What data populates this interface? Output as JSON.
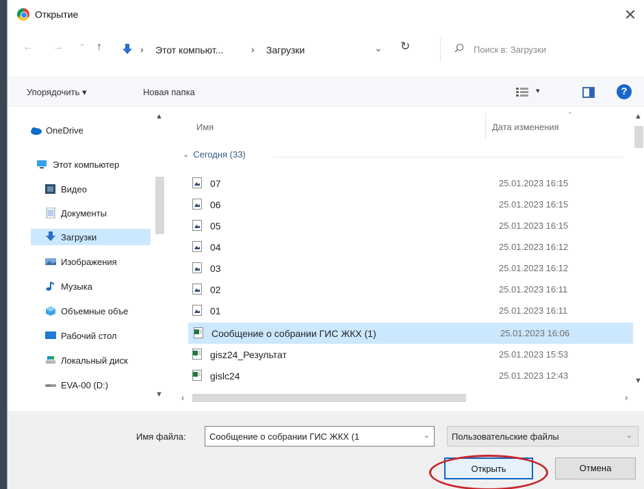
{
  "window": {
    "title": "Открытие",
    "close_glyph": "✕"
  },
  "address": {
    "back_glyph": "←",
    "forward_glyph": "→",
    "history_glyph": "⌄",
    "up_glyph": "↑",
    "crumbs": [
      "Этот компьют...",
      "Загрузки"
    ],
    "separator": "›",
    "dropdown_glyph": "⌄",
    "refresh_glyph": "↻",
    "search_placeholder": "Поиск в: Загрузки"
  },
  "toolbar": {
    "organize": "Упорядочить ▾",
    "new_folder": "Новая папка",
    "view_drop": "▾",
    "help": "?"
  },
  "nav": {
    "items": [
      {
        "label": "OneDrive",
        "icon": "cloud-icon"
      },
      {
        "label": "Этот компьютер",
        "icon": "computer-icon"
      },
      {
        "label": "Видео",
        "icon": "video-icon"
      },
      {
        "label": "Документы",
        "icon": "documents-icon"
      },
      {
        "label": "Загрузки",
        "icon": "downloads-icon",
        "selected": true
      },
      {
        "label": "Изображения",
        "icon": "images-icon"
      },
      {
        "label": "Музыка",
        "icon": "music-icon"
      },
      {
        "label": "Объемные объе",
        "icon": "3d-objects-icon"
      },
      {
        "label": "Рабочий стол",
        "icon": "desktop-icon"
      },
      {
        "label": "Локальный диск",
        "icon": "local-disk-icon"
      },
      {
        "label": "EVA-00 (D:)",
        "icon": "drive-icon"
      }
    ]
  },
  "filelist": {
    "col_name": "Имя",
    "col_date": "Дата изменения",
    "group": "Сегодня (33)",
    "rows": [
      {
        "name": "07",
        "date": "25.01.2023 16:15",
        "icon": "image-file-icon"
      },
      {
        "name": "06",
        "date": "25.01.2023 16:15",
        "icon": "image-file-icon"
      },
      {
        "name": "05",
        "date": "25.01.2023 16:15",
        "icon": "image-file-icon"
      },
      {
        "name": "04",
        "date": "25.01.2023 16:12",
        "icon": "image-file-icon"
      },
      {
        "name": "03",
        "date": "25.01.2023 16:12",
        "icon": "image-file-icon"
      },
      {
        "name": "02",
        "date": "25.01.2023 16:11",
        "icon": "image-file-icon"
      },
      {
        "name": "01",
        "date": "25.01.2023 16:11",
        "icon": "image-file-icon"
      },
      {
        "name": "Сообщение о собрании ГИС ЖКХ (1)",
        "date": "25.01.2023 16:06",
        "icon": "excel-file-icon",
        "selected": true
      },
      {
        "name": "gisz24_Результат",
        "date": "25.01.2023 15:53",
        "icon": "excel-file-icon"
      },
      {
        "name": "gislc24",
        "date": "25.01.2023 12:43",
        "icon": "excel-file-icon"
      }
    ]
  },
  "footer": {
    "filename_label": "Имя файла:",
    "filename_value": "Сообщение о собрании ГИС ЖКХ (1",
    "filetype_value": "Пользовательские файлы",
    "open_label": "Открыть",
    "cancel_label": "Отмена"
  },
  "colors": {
    "selection": "#cce8ff",
    "accent": "#0a66c2",
    "annotation_ring": "#c8252c"
  }
}
